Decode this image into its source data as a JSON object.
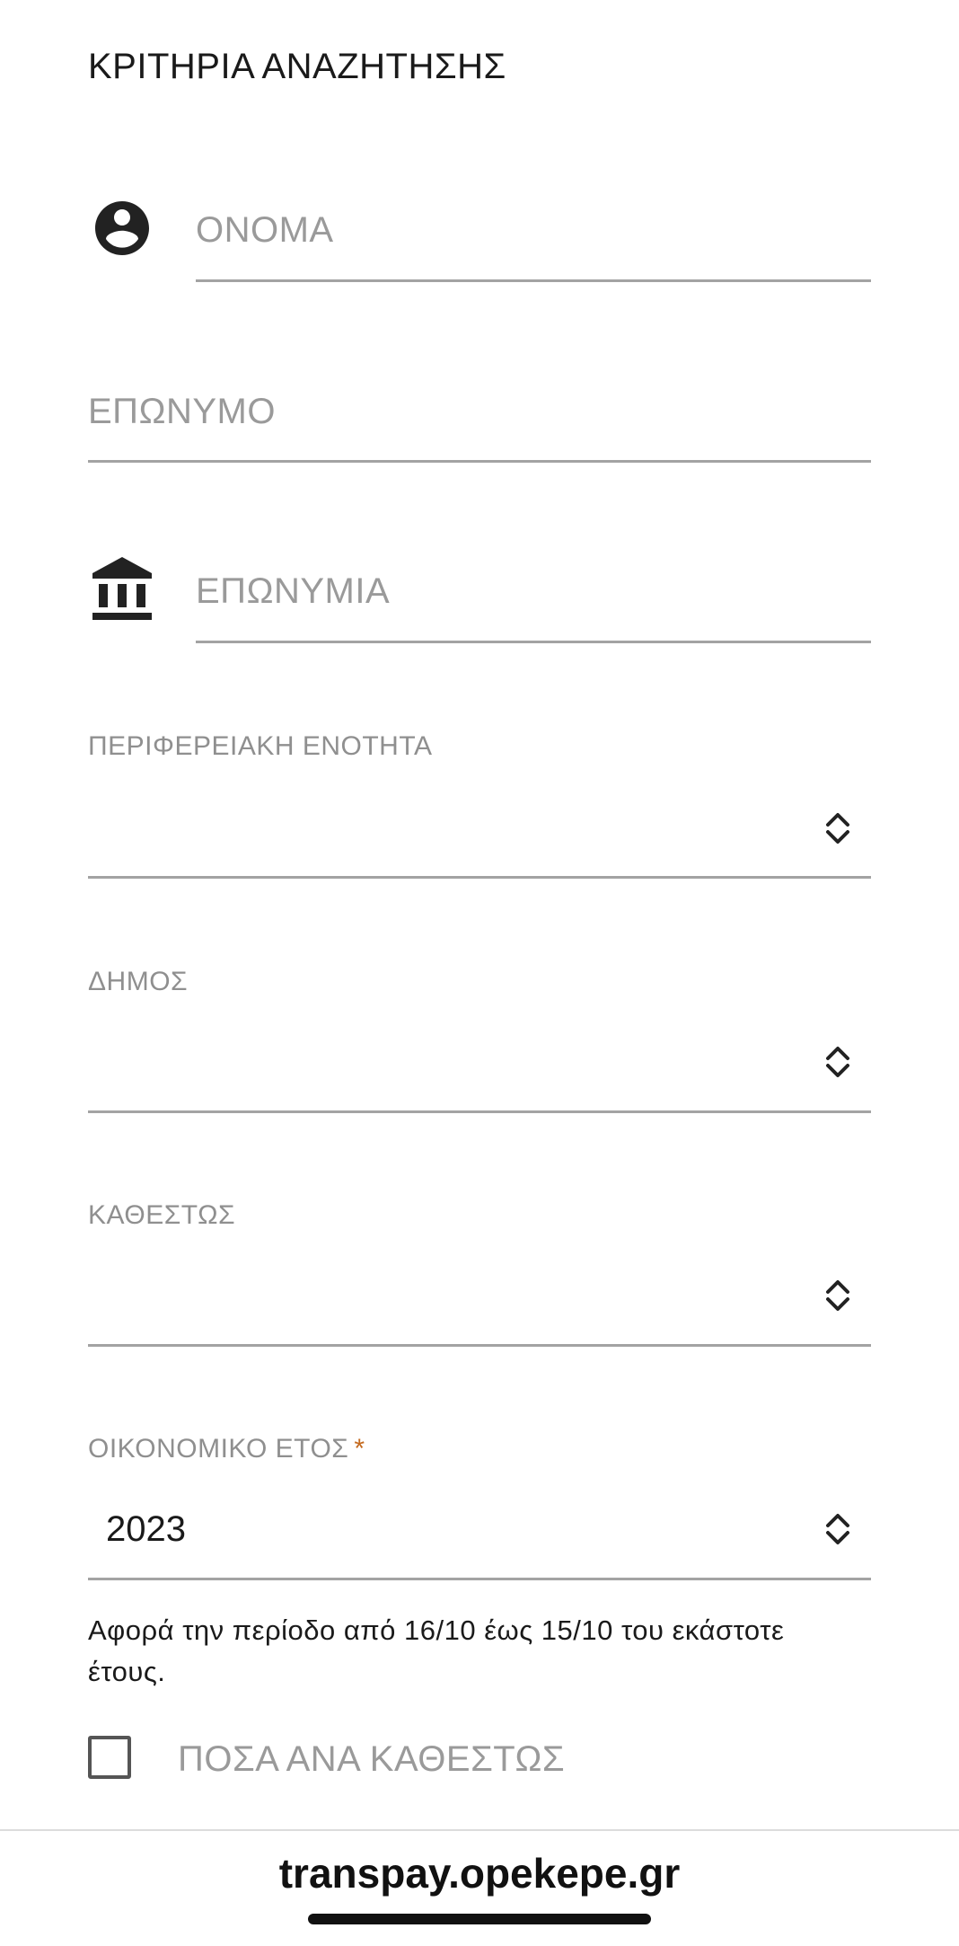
{
  "header": {
    "title": "ΚΡΙΤΗΡΙΑ ΑΝΑΖΗΤΗΣΗΣ"
  },
  "fields": {
    "first_name": {
      "placeholder": "ΟΝΟΜΑ",
      "icon": "account-circle-icon"
    },
    "last_name": {
      "placeholder": "ΕΠΩΝΥΜΟ"
    },
    "company_name": {
      "placeholder": "ΕΠΩΝΥΜΙΑ",
      "icon": "bank-building-icon"
    }
  },
  "selects": {
    "regional_unit": {
      "label": "ΠΕΡΙΦΕΡΕΙΑΚΗ ΕΝΟΤΗΤΑ",
      "value": ""
    },
    "municipality": {
      "label": "ΔΗΜΟΣ",
      "value": ""
    },
    "status": {
      "label": "ΚΑΘΕΣΤΩΣ",
      "value": ""
    },
    "fiscal_year": {
      "label": "ΟΙΚΟΝΟΜΙΚΟ ΕΤΟΣ",
      "required_mark": "*",
      "value": "2023"
    }
  },
  "helper": {
    "fiscal_year_note": "Αφορά την περίοδο από 16/10 έως 15/10 του εκάστοτε έτους."
  },
  "checkbox": {
    "label": "ΠΟΣΑ ΑΝΑ ΚΑΘΕΣΤΩΣ",
    "checked": false
  },
  "browser": {
    "url": "transpay.opekepe.gr"
  },
  "colors": {
    "text": "#1a1a1a",
    "placeholder": "#9a9a9a",
    "underline": "#a3a3a3",
    "required": "#c46a1f"
  }
}
